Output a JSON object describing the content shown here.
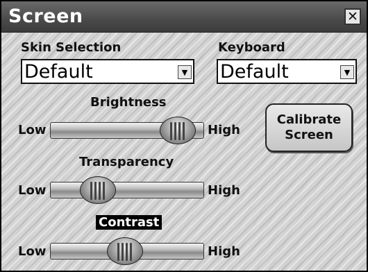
{
  "window": {
    "title": "Screen",
    "close_glyph": "✕"
  },
  "skin_selection": {
    "label": "Skin Selection",
    "value": "Default"
  },
  "keyboard": {
    "label": "Keyboard",
    "value": "Default"
  },
  "calibrate_button": {
    "label": "Calibrate\nScreen"
  },
  "sliders": {
    "brightness": {
      "label": "Brightness",
      "low": "Low",
      "high": "High",
      "value": 0.93
    },
    "transparency": {
      "label": "Transparency",
      "low": "Low",
      "high": "High",
      "value": 0.25
    },
    "contrast": {
      "label": "Contrast",
      "low": "Low",
      "high": "High",
      "value": 0.48
    }
  },
  "dropdown_arrow_icon": "triangle-down"
}
